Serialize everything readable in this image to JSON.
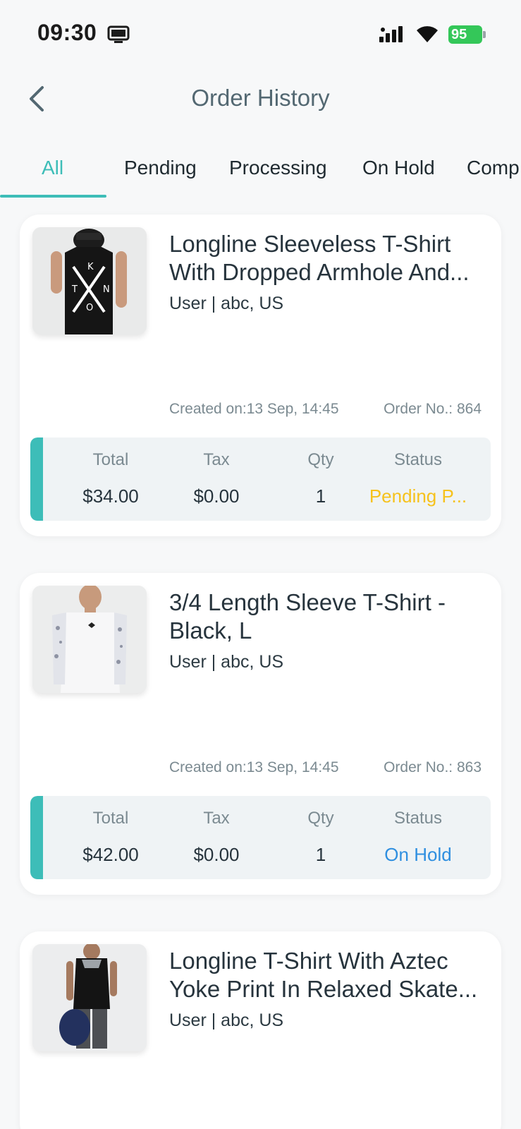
{
  "status_bar": {
    "time": "09:30",
    "battery": "95"
  },
  "header": {
    "title": "Order History"
  },
  "tabs": [
    {
      "label": "All",
      "active": true
    },
    {
      "label": "Pending"
    },
    {
      "label": "Processing"
    },
    {
      "label": "On Hold"
    },
    {
      "label": "Comp"
    }
  ],
  "labels": {
    "total": "Total",
    "tax": "Tax",
    "qty": "Qty",
    "status": "Status"
  },
  "orders": [
    {
      "title": "Longline Sleeveless T-Shirt With Dropped Armhole And...",
      "subtitle": "User | abc, US",
      "created": "Created on:13 Sep, 14:45",
      "order_no": "Order No.: 864",
      "total": "$34.00",
      "tax": "$0.00",
      "qty": "1",
      "status": "Pending P...",
      "status_color": "#f6c21c"
    },
    {
      "title": "3/4 Length Sleeve T-Shirt - Black, L",
      "subtitle": "User | abc, US",
      "created": "Created on:13 Sep, 14:45",
      "order_no": "Order No.: 863",
      "total": "$42.00",
      "tax": "$0.00",
      "qty": "1",
      "status": "On Hold",
      "status_color": "#2f8fe0"
    },
    {
      "title": "Longline T-Shirt With Aztec Yoke Print In Relaxed Skate...",
      "subtitle": "User | abc, US"
    }
  ],
  "colors": {
    "accent": "#3dbdb8",
    "pending": "#f6c21c",
    "on_hold": "#2f8fe0"
  }
}
